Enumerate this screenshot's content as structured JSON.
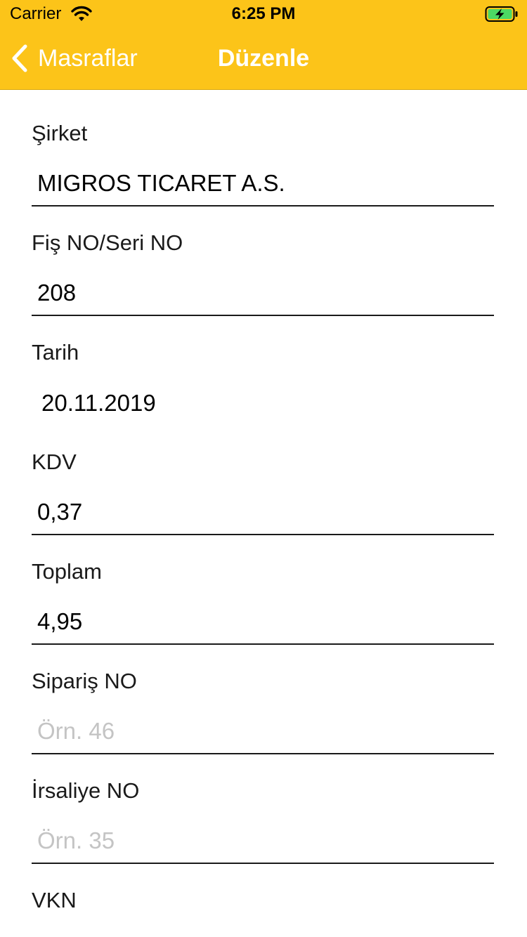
{
  "status_bar": {
    "carrier": "Carrier",
    "time": "6:25 PM"
  },
  "nav": {
    "back_label": "Masraflar",
    "title": "Düzenle"
  },
  "colors": {
    "header": "#FCC419",
    "battery_fill": "#4CD964"
  },
  "fields": [
    {
      "label": "Şirket",
      "value": "MIGROS TICARET A.S.",
      "placeholder": ""
    },
    {
      "label": "Fiş NO/Seri NO",
      "value": "208",
      "placeholder": ""
    },
    {
      "label": "Tarih",
      "value": "20.11.2019",
      "placeholder": ""
    },
    {
      "label": "KDV",
      "value": "0,37",
      "placeholder": ""
    },
    {
      "label": "Toplam",
      "value": "4,95",
      "placeholder": ""
    },
    {
      "label": "Sipariş NO",
      "value": "",
      "placeholder": "Örn. 46"
    },
    {
      "label": "İrsaliye NO",
      "value": "",
      "placeholder": "Örn. 35"
    },
    {
      "label": "VKN",
      "value": "",
      "placeholder": ""
    }
  ]
}
